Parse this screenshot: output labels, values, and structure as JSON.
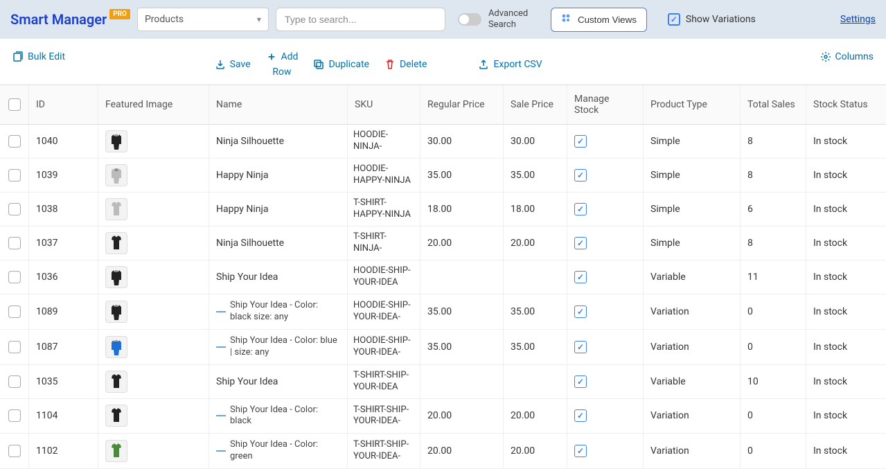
{
  "header": {
    "logo": "Smart Manager",
    "pro": "PRO",
    "dashboard": "Products",
    "search_placeholder": "Type to search...",
    "advanced_search": "Advanced Search",
    "custom_views": "Custom Views",
    "show_variations": "Show Variations",
    "settings": "Settings"
  },
  "toolbar": {
    "bulk_edit": "Bulk Edit",
    "save": "Save",
    "add_row": "Add Row",
    "duplicate": "Duplicate",
    "delete": "Delete",
    "export_csv": "Export CSV",
    "columns": "Columns"
  },
  "columns": {
    "id": "ID",
    "featured_image": "Featured Image",
    "name": "Name",
    "sku": "SKU",
    "regular_price": "Regular Price",
    "sale_price": "Sale Price",
    "manage_stock": "Manage Stock",
    "product_type": "Product Type",
    "total_sales": "Total Sales",
    "stock_status": "Stock Status"
  },
  "rows": [
    {
      "id": "1040",
      "name": "Ninja Silhouette",
      "sku": "HOODIE-NINJA-",
      "reg": "30.00",
      "sale": "30.00",
      "ms": true,
      "type": "Simple",
      "sales": "8",
      "stock": "In stock",
      "img": "hoodie-black",
      "variation": false
    },
    {
      "id": "1039",
      "name": "Happy Ninja",
      "sku": "HOODIE-HAPPY-NINJA",
      "reg": "35.00",
      "sale": "35.00",
      "ms": true,
      "type": "Simple",
      "sales": "8",
      "stock": "In stock",
      "img": "hoodie-grey",
      "variation": false
    },
    {
      "id": "1038",
      "name": "Happy Ninja",
      "sku": "T-SHIRT-HAPPY-NINJA",
      "reg": "18.00",
      "sale": "18.00",
      "ms": true,
      "type": "Simple",
      "sales": "6",
      "stock": "In stock",
      "img": "tshirt-grey",
      "variation": false
    },
    {
      "id": "1037",
      "name": "Ninja Silhouette",
      "sku": "T-SHIRT-NINJA-",
      "reg": "20.00",
      "sale": "20.00",
      "ms": true,
      "type": "Simple",
      "sales": "8",
      "stock": "In stock",
      "img": "tshirt-black",
      "variation": false
    },
    {
      "id": "1036",
      "name": "Ship Your Idea",
      "sku": "HOODIE-SHIP-YOUR-IDEA",
      "reg": "",
      "sale": "",
      "ms": true,
      "type": "Variable",
      "sales": "11",
      "stock": "In stock",
      "img": "hoodie-black",
      "variation": false
    },
    {
      "id": "1089",
      "name": "Ship Your Idea - Color: black size: any",
      "sku": "HOODIE-SHIP-YOUR-IDEA-",
      "reg": "35.00",
      "sale": "35.00",
      "ms": true,
      "type": "Variation",
      "sales": "0",
      "stock": "In stock",
      "img": "hoodie-black",
      "variation": true
    },
    {
      "id": "1087",
      "name": "Ship Your Idea - Color: blue | size: any",
      "sku": "HOODIE-SHIP-YOUR-IDEA-",
      "reg": "35.00",
      "sale": "35.00",
      "ms": true,
      "type": "Variation",
      "sales": "0",
      "stock": "In stock",
      "img": "hoodie-blue",
      "variation": true
    },
    {
      "id": "1035",
      "name": "Ship Your Idea",
      "sku": "T-SHIRT-SHIP-YOUR-IDEA",
      "reg": "",
      "sale": "",
      "ms": true,
      "type": "Variable",
      "sales": "10",
      "stock": "In stock",
      "img": "tshirt-black",
      "variation": false
    },
    {
      "id": "1104",
      "name": "Ship Your Idea - Color: black",
      "sku": "T-SHIRT-SHIP-YOUR-IDEA-",
      "reg": "20.00",
      "sale": "20.00",
      "ms": true,
      "type": "Variation",
      "sales": "0",
      "stock": "In stock",
      "img": "tshirt-black",
      "variation": true
    },
    {
      "id": "1102",
      "name": "Ship Your Idea - Color: green",
      "sku": "T-SHIRT-SHIP-YOUR-IDEA-",
      "reg": "20.00",
      "sale": "20.00",
      "ms": true,
      "type": "Variation",
      "sales": "0",
      "stock": "In stock",
      "img": "tshirt-green",
      "variation": true
    }
  ]
}
